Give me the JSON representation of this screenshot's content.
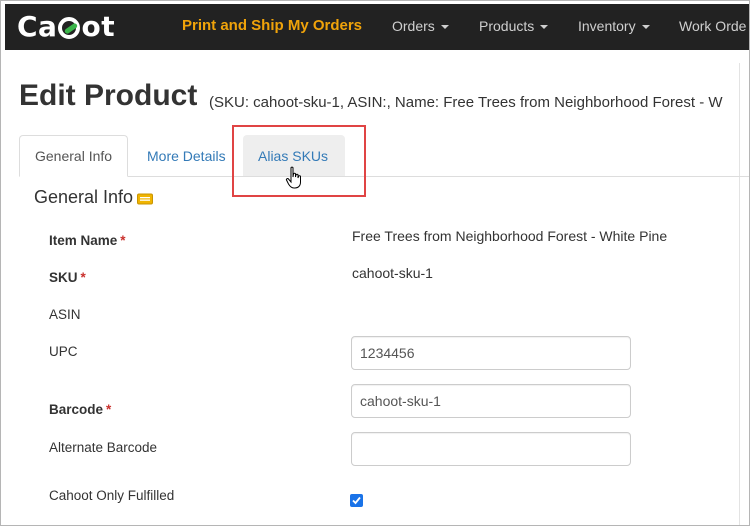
{
  "navbar": {
    "brand": "Cahoot",
    "items": [
      {
        "label": "Print and Ship My Orders",
        "highlight": true
      },
      {
        "label": "Orders",
        "dropdown": true
      },
      {
        "label": "Products",
        "dropdown": true
      },
      {
        "label": "Inventory",
        "dropdown": true
      },
      {
        "label": "Work Orde",
        "dropdown": false
      }
    ],
    "accent_color": "#f0a30a"
  },
  "page": {
    "title": "Edit Product",
    "subtitle": "(SKU: cahoot-sku-1, ASIN:, Name: Free Trees from Neighborhood Forest - W"
  },
  "tabs": [
    {
      "label": "General Info",
      "state": "active"
    },
    {
      "label": "More Details",
      "state": "normal"
    },
    {
      "label": "Alias SKUs",
      "state": "hover"
    }
  ],
  "section": {
    "title": "General Info",
    "icon": "info-badge-icon"
  },
  "form": {
    "item_name": {
      "label": "Item Name",
      "required": "*",
      "value": "Free Trees from Neighborhood Forest - White Pine"
    },
    "sku": {
      "label": "SKU",
      "required": "*",
      "value": "cahoot-sku-1"
    },
    "asin": {
      "label": "ASIN",
      "value": ""
    },
    "upc": {
      "label": "UPC",
      "value": "1234456"
    },
    "barcode": {
      "label": "Barcode",
      "required": "*",
      "value": "cahoot-sku-1"
    },
    "alternate_barcode": {
      "label": "Alternate Barcode",
      "value": ""
    },
    "cahoot_only_fulfilled": {
      "label": "Cahoot Only Fulfilled",
      "checked": true
    }
  },
  "annotation": {
    "highlight_color": "#e04444",
    "target": "Alias SKUs"
  }
}
